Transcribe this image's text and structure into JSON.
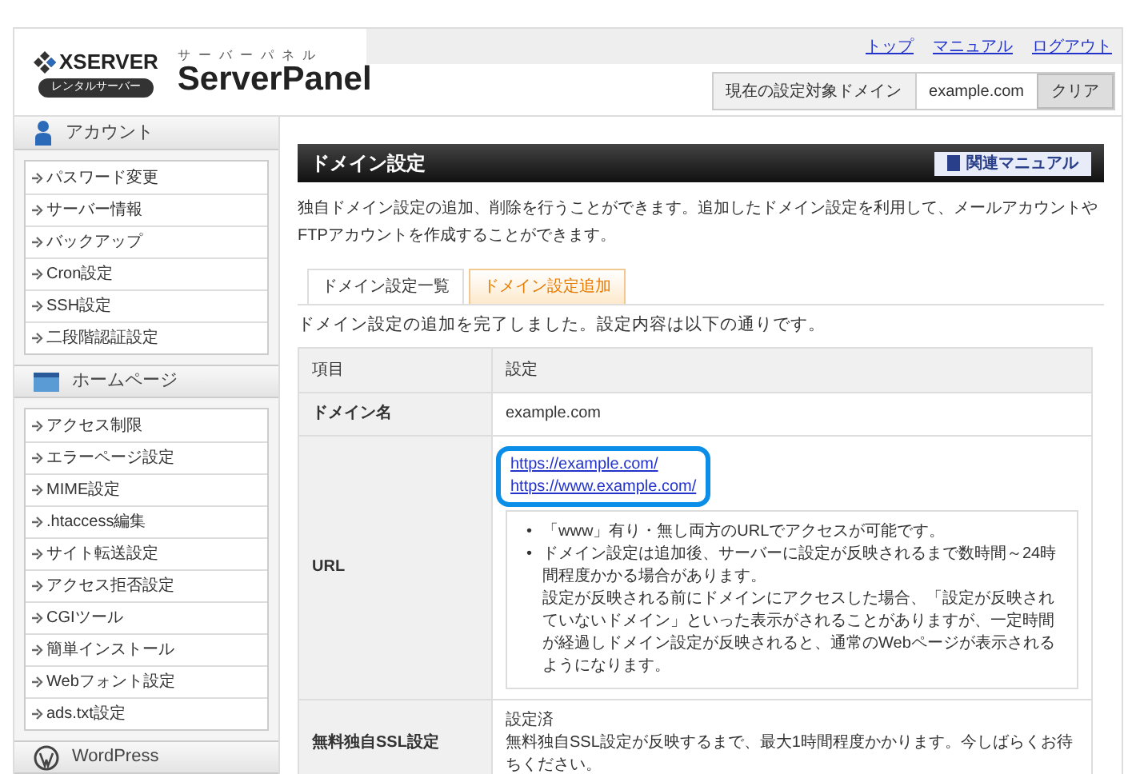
{
  "header": {
    "logo": {
      "brand": "XSERVER",
      "badge": "レンタルサーバー"
    },
    "product": {
      "kana": "サーバーパネル",
      "name": "ServerPanel"
    },
    "links": [
      "トップ",
      "マニュアル",
      "ログアウト"
    ],
    "target_domain": {
      "label": "現在の設定対象ドメイン",
      "value": "example.com",
      "button": "クリア"
    }
  },
  "sidebar": {
    "sections": [
      {
        "kind": "account",
        "title": "アカウント",
        "items": [
          "パスワード変更",
          "サーバー情報",
          "バックアップ",
          "Cron設定",
          "SSH設定",
          "二段階認証設定"
        ]
      },
      {
        "kind": "homepage",
        "title": "ホームページ",
        "items": [
          "アクセス制限",
          "エラーページ設定",
          "MIME設定",
          ".htaccess編集",
          "サイト転送設定",
          "アクセス拒否設定",
          "CGIツール",
          "簡単インストール",
          "Webフォント設定",
          "ads.txt設定"
        ]
      },
      {
        "kind": "wordpress",
        "title": "WordPress"
      }
    ]
  },
  "main": {
    "title": "ドメイン設定",
    "manual_button": "関連マニュアル",
    "description": "独自ドメイン設定の追加、削除を行うことができます。追加したドメイン設定を利用して、メールアカウントやFTPアカウントを作成することができます。",
    "tabs": [
      {
        "label": "ドメイン設定一覧",
        "selected": false
      },
      {
        "label": "ドメイン設定追加",
        "selected": true
      }
    ],
    "status": "ドメイン設定の追加を完了しました。設定内容は以下の通りです。",
    "table": {
      "columns": [
        "項目",
        "設定"
      ],
      "rows": [
        {
          "label": "ドメイン名",
          "kind": "text",
          "lines": [
            "example.com"
          ]
        },
        {
          "label": "URL",
          "kind": "links",
          "links": [
            "https://example.com/",
            "https://www.example.com/"
          ],
          "highlighted": true,
          "notes": [
            {
              "marker": "•",
              "paragraphs": [
                "「www」有り・無し両方のURLでアクセスが可能です。"
              ]
            },
            {
              "marker": "•",
              "paragraphs": [
                "ドメイン設定は追加後、サーバーに設定が反映されるまで数時間～24時間程度かかる場合があります。",
                "設定が反映される前にドメインにアクセスした場合、「設定が反映されていないドメイン」といった表示がされることがありますが、一定時間が経過しドメイン設定が反映されると、通常のWebページが表示されるようになります。"
              ]
            }
          ]
        },
        {
          "label": "無料独自SSL設定",
          "kind": "text",
          "lines": [
            "設定済",
            "無料独自SSL設定が反映するまで、最大1時間程度かかります。今しばらくお待ちください。"
          ]
        }
      ]
    }
  }
}
